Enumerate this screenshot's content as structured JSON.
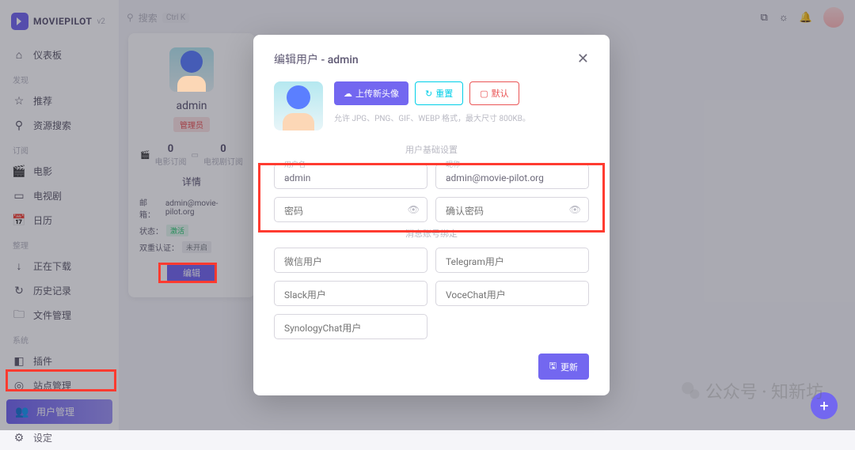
{
  "brand": {
    "name": "MOVIEPILOT",
    "version": "v2"
  },
  "search": {
    "placeholder": "搜索",
    "shortcut": "Ctrl K"
  },
  "nav": {
    "dashboard": "仪表板",
    "s_discover": "发现",
    "recommend": "推荐",
    "resource": "资源搜索",
    "s_subscribe": "订阅",
    "movie": "电影",
    "tv": "电视剧",
    "calendar": "日历",
    "s_manage": "整理",
    "downloading": "正在下载",
    "history": "历史记录",
    "files": "文件管理",
    "s_system": "系统",
    "plugin": "插件",
    "site": "站点管理",
    "user": "用户管理",
    "setting": "设定"
  },
  "profile": {
    "username": "admin",
    "role": "管理员",
    "movie_count": "0",
    "movie_label": "电影订阅",
    "tv_count": "0",
    "tv_label": "电视剧订阅",
    "details_title": "详情",
    "email_label": "邮箱：",
    "email": "admin@movie-pilot.org",
    "status_label": "状态：",
    "status": "激活",
    "twofa_label": "双重认证：",
    "twofa": "未开启",
    "edit_btn": "编辑"
  },
  "modal": {
    "title": "编辑用户 - admin",
    "upload_btn": "上传新头像",
    "reset_btn": "重置",
    "default_btn": "默认",
    "upload_hint": "允许 JPG、PNG、GIF、WEBP 格式，最大尺寸 800KB。",
    "section_basic": "用户基础设置",
    "username_label": "用户名",
    "username_value": "admin",
    "nickname_label": "昵称",
    "nickname_value": "admin@movie-pilot.org",
    "password_ph": "密码",
    "confirm_ph": "确认密码",
    "section_bind": "消息账号绑定",
    "wechat_ph": "微信用户",
    "telegram_ph": "Telegram用户",
    "slack_ph": "Slack用户",
    "vocechat_ph": "VoceChat用户",
    "synology_ph": "SynologyChat用户",
    "update_btn": "更新"
  },
  "watermark": "公众号 · 知新坊"
}
